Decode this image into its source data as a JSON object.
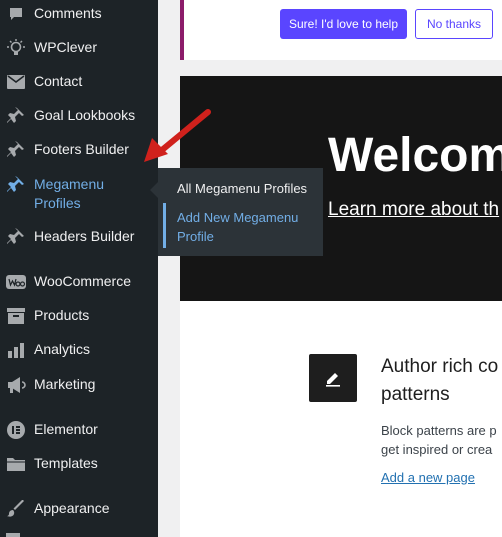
{
  "sidebar": {
    "items": [
      {
        "label": "Comments",
        "icon": "comments-icon"
      },
      {
        "label": "WPClever",
        "icon": "lightbulb-icon"
      },
      {
        "label": "Contact",
        "icon": "envelope-icon"
      },
      {
        "label": "Goal Lookbooks",
        "icon": "pin-icon"
      },
      {
        "label": "Footers Builder",
        "icon": "pin-icon"
      },
      {
        "label": "Megamenu",
        "label2": "Profiles",
        "icon": "pin-icon"
      },
      {
        "label": "Headers Builder",
        "icon": "pin-icon"
      },
      {
        "label": "WooCommerce",
        "icon": "woo-icon"
      },
      {
        "label": "Products",
        "icon": "archive-icon"
      },
      {
        "label": "Analytics",
        "icon": "bar-chart-icon"
      },
      {
        "label": "Marketing",
        "icon": "megaphone-icon"
      },
      {
        "label": "Elementor",
        "icon": "elementor-icon"
      },
      {
        "label": "Templates",
        "icon": "folder-icon"
      },
      {
        "label": "Appearance",
        "icon": "brush-icon"
      }
    ]
  },
  "flyout": {
    "items": [
      {
        "label": "All Megamenu Profiles"
      },
      {
        "label": "Add New Megamenu",
        "label2": "Profile"
      }
    ]
  },
  "notice": {
    "primary_label": "Sure! I'd love to help",
    "secondary_label": "No thanks"
  },
  "welcome": {
    "title": "Welcom",
    "link": "Learn more about th"
  },
  "panel": {
    "title_line1": "Author rich co",
    "title_line2": "patterns",
    "desc_line1": "Block patterns are p",
    "desc_line2": "get inspired or crea",
    "link": "Add a new page"
  },
  "colors": {
    "sidebar_bg": "#1d2327",
    "accent": "#72aee6",
    "button": "#5a45ff",
    "arrow": "#d0211c"
  }
}
